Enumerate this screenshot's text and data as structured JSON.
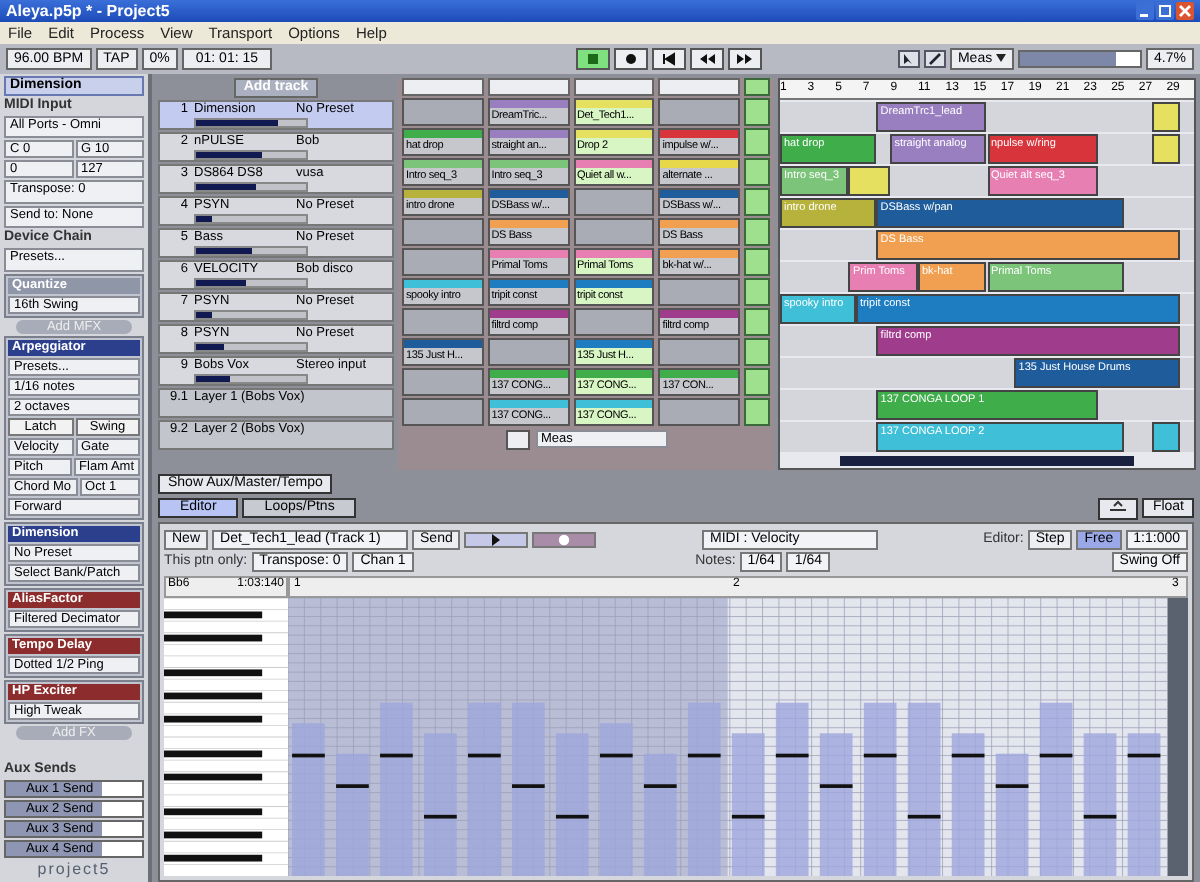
{
  "window": {
    "title": "Aleya.p5p * - Project5"
  },
  "menu": [
    "File",
    "Edit",
    "Process",
    "View",
    "Transport",
    "Options",
    "Help"
  ],
  "toolbar": {
    "tempo": "96.00 BPM",
    "tap": "TAP",
    "swing": "0%",
    "position": "01: 01: 15",
    "snap": "Meas",
    "zoom": "4.7%",
    "zoom_slider": {
      "level": 0.8
    },
    "transport": [
      {
        "kind": "play",
        "selected": true
      },
      {
        "kind": "record",
        "selected": false
      },
      {
        "kind": "start",
        "selected": false
      },
      {
        "kind": "rewind",
        "selected": false
      },
      {
        "kind": "forward",
        "selected": false
      }
    ]
  },
  "instrument_panel": {
    "title": "Dimension",
    "midi_input": "MIDI Input",
    "port": "All Ports - Omni",
    "low_note": "C 0",
    "high_note": "G 10",
    "low_velocity": "0",
    "high_velocity": "127",
    "transpose": "Transpose: 0",
    "send_to": "Send to: None"
  },
  "device_chain": {
    "title": "Device Chain",
    "presets": "Presets...",
    "quantize": {
      "title": "Quantize",
      "value": "16th Swing"
    },
    "add_mfx": "Add MFX",
    "arpeggiator": {
      "title": "Arpeggiator",
      "presets": "Presets...",
      "rate": "1/16 notes",
      "octaves": "2 octaves",
      "buttons": [
        "Latch",
        "Swing"
      ],
      "params": [
        "Velocity",
        "Gate",
        "Pitch",
        "Flam Amt"
      ],
      "chord": "Chord Mo",
      "octave": "Oct 1",
      "direction": "Forward"
    },
    "effects": [
      {
        "kind": "synth",
        "title": "Dimension",
        "values": [
          "No Preset",
          "Select Bank/Patch"
        ]
      },
      {
        "kind": "fx",
        "title": "AliasFactor",
        "values": [
          "Filtered Decimator"
        ]
      },
      {
        "kind": "fx",
        "title": "Tempo Delay",
        "values": [
          "Dotted 1/2 Ping"
        ]
      },
      {
        "kind": "fx",
        "title": "HP Exciter",
        "values": [
          "High Tweak"
        ]
      }
    ],
    "add_fx": "Add FX"
  },
  "aux_sends": {
    "title": "Aux Sends",
    "sends": [
      {
        "label": "Aux 1 Send",
        "level": 0.7
      },
      {
        "label": "Aux 2 Send",
        "level": 0.7
      },
      {
        "label": "Aux 3 Send",
        "level": 0.7
      },
      {
        "label": "Aux 4 Send",
        "level": 0.7
      }
    ]
  },
  "logo": "project5",
  "add_track": "Add track",
  "tracks": [
    {
      "kind": "track",
      "number": "1",
      "name": "Dimension",
      "preset": "No Preset",
      "selected": true,
      "level": 0.75
    },
    {
      "kind": "track",
      "number": "2",
      "name": "nPULSE",
      "preset": "Bob",
      "selected": false,
      "level": 0.6
    },
    {
      "kind": "track",
      "number": "3",
      "name": "DS864 DS8",
      "preset": "vusa",
      "selected": false,
      "level": 0.55
    },
    {
      "kind": "track",
      "number": "4",
      "name": "PSYN",
      "preset": "No Preset",
      "selected": false,
      "level": 0.15
    },
    {
      "kind": "track",
      "number": "5",
      "name": "Bass",
      "preset": "No Preset",
      "selected": false,
      "level": 0.5
    },
    {
      "kind": "track",
      "number": "6",
      "name": "VELOCITY",
      "preset": "Bob disco",
      "selected": false,
      "level": 0.45
    },
    {
      "kind": "track",
      "number": "7",
      "name": "PSYN",
      "preset": "No Preset",
      "selected": false,
      "level": 0.15
    },
    {
      "kind": "track",
      "number": "8",
      "name": "PSYN",
      "preset": "No Preset",
      "selected": false,
      "level": 0.25
    },
    {
      "kind": "track",
      "number": "9",
      "name": "Bobs Vox",
      "preset": "Stereo input",
      "selected": false,
      "level": 0.3
    },
    {
      "kind": "layer",
      "number": "9.1",
      "name": "Layer 1 (Bobs Vox)",
      "selected": false
    },
    {
      "kind": "layer",
      "number": "9.2",
      "name": "Layer 2 (Bobs Vox)",
      "selected": false
    }
  ],
  "clip_grid": {
    "snap": "Meas",
    "rows": [
      [
        {
          "kind": "empty"
        },
        {
          "kind": "clip",
          "name": "DreamTric...",
          "color": "#9a7fc0",
          "playing": false
        },
        {
          "kind": "clip",
          "name": "Det_Tech1...",
          "color": "#e6e060",
          "playing": true
        },
        {
          "kind": "empty"
        }
      ],
      [
        {
          "kind": "clip",
          "name": "hat drop",
          "color": "#3fae4a",
          "playing": false
        },
        {
          "kind": "clip",
          "name": "straight an...",
          "color": "#9a7fc0",
          "playing": false
        },
        {
          "kind": "clip",
          "name": "Drop 2",
          "color": "#e6e060",
          "playing": true
        },
        {
          "kind": "clip",
          "name": "impulse w/...",
          "color": "#d8343c",
          "playing": false
        }
      ],
      [
        {
          "kind": "clip",
          "name": "Intro seq_3",
          "color": "#7cc47a",
          "playing": false
        },
        {
          "kind": "clip",
          "name": "Intro seq_3",
          "color": "#7cc47a",
          "playing": false
        },
        {
          "kind": "clip",
          "name": "Quiet all w...",
          "color": "#e77fb2",
          "playing": true
        },
        {
          "kind": "clip",
          "name": "alternate ...",
          "color": "#e6d84a",
          "playing": false
        }
      ],
      [
        {
          "kind": "clip",
          "name": "intro drone",
          "color": "#b6b23c",
          "playing": false
        },
        {
          "kind": "clip",
          "name": "DSBass w/...",
          "color": "#1e5c9c",
          "playing": false
        },
        {
          "kind": "empty"
        },
        {
          "kind": "clip",
          "name": "DSBass w/...",
          "color": "#1e5c9c",
          "playing": false
        }
      ],
      [
        {
          "kind": "empty"
        },
        {
          "kind": "clip",
          "name": "DS Bass",
          "color": "#f0a050",
          "playing": false
        },
        {
          "kind": "empty"
        },
        {
          "kind": "clip",
          "name": "DS Bass",
          "color": "#f0a050",
          "playing": false
        }
      ],
      [
        {
          "kind": "empty"
        },
        {
          "kind": "clip",
          "name": "Primal Toms",
          "color": "#e77fb2",
          "playing": false
        },
        {
          "kind": "clip",
          "name": "Primal Toms",
          "color": "#e77fb2",
          "playing": true
        },
        {
          "kind": "clip",
          "name": "bk-hat w/...",
          "color": "#f0a050",
          "playing": false
        }
      ],
      [
        {
          "kind": "clip",
          "name": "spooky intro",
          "color": "#3fc0d8",
          "playing": false
        },
        {
          "kind": "clip",
          "name": "tripit const",
          "color": "#1e7cc0",
          "playing": false
        },
        {
          "kind": "clip",
          "name": "tripit const",
          "color": "#1e7cc0",
          "playing": true
        },
        {
          "kind": "empty"
        }
      ],
      [
        {
          "kind": "empty"
        },
        {
          "kind": "clip",
          "name": "filtrd comp",
          "color": "#a03c8c",
          "playing": false
        },
        {
          "kind": "empty"
        },
        {
          "kind": "clip",
          "name": "filtrd comp",
          "color": "#a03c8c",
          "playing": false
        }
      ],
      [
        {
          "kind": "clip",
          "name": "135 Just H...",
          "color": "#1e5c9c",
          "playing": false
        },
        {
          "kind": "empty"
        },
        {
          "kind": "clip",
          "name": "135 Just H...",
          "color": "#1e7cc0",
          "playing": true
        },
        {
          "kind": "empty"
        }
      ],
      [
        {
          "kind": "empty"
        },
        {
          "kind": "clip",
          "name": "137 CONG...",
          "color": "#3fae4a",
          "playing": false
        },
        {
          "kind": "clip",
          "name": "137 CONG...",
          "color": "#3fae4a",
          "playing": true
        },
        {
          "kind": "clip",
          "name": "137 CON...",
          "color": "#3fae4a",
          "playing": false
        }
      ],
      [
        {
          "kind": "empty"
        },
        {
          "kind": "clip",
          "name": "137 CONG...",
          "color": "#3fc0d8",
          "playing": false
        },
        {
          "kind": "clip",
          "name": "137 CONG...",
          "color": "#3fc0d8",
          "playing": true
        },
        {
          "kind": "empty"
        }
      ]
    ]
  },
  "arrangement": {
    "ruler": [
      "1",
      "3",
      "5",
      "7",
      "9",
      "11",
      "13",
      "15",
      "17",
      "19",
      "21",
      "23",
      "25",
      "27",
      "29"
    ],
    "rows": [
      [
        {
          "name": "DreamTrc1_lead",
          "color": "#9a7fc0"
        },
        {
          "color": "#e6e060"
        }
      ],
      [
        {
          "name": "hat drop",
          "color": "#3fae4a"
        },
        {
          "name": "straight analog",
          "color": "#9a7fc0"
        },
        {
          "name": "npulse w/ring",
          "color": "#d8343c"
        },
        {
          "color": "#e6e060"
        }
      ],
      [
        {
          "name": "Intro seq_3",
          "color": "#7cc47a"
        },
        {
          "color": "#e6e060"
        },
        {
          "name": "Quiet alt seq_3",
          "color": "#e77fb2"
        }
      ],
      [
        {
          "name": "intro drone",
          "color": "#b6b23c"
        },
        {
          "name": "DSBass w/pan",
          "color": "#1e5c9c"
        }
      ],
      [
        {
          "name": "DS Bass",
          "color": "#f0a050"
        }
      ],
      [
        {
          "name": "Prim Toms",
          "color": "#e77fb2"
        },
        {
          "name": "bk-hat",
          "color": "#f0a050"
        },
        {
          "name": "Primal Toms",
          "color": "#7cc47a"
        }
      ],
      [
        {
          "name": "spooky intro",
          "color": "#3fc0d8"
        },
        {
          "name": "tripit const",
          "color": "#1e7cc0"
        }
      ],
      [
        {
          "name": "filtrd comp",
          "color": "#a03c8c"
        }
      ],
      [
        {
          "name": "135 Just House Drums",
          "color": "#1e5c9c"
        }
      ],
      [
        {
          "name": "137 CONGA LOOP 1",
          "color": "#3fae4a"
        }
      ],
      [
        {
          "name": "137 CONGA LOOP 2",
          "color": "#3fc0d8"
        },
        {
          "color": "#3fc0d8"
        }
      ]
    ]
  },
  "editor": {
    "show_aux": "Show Aux/Master/Tempo",
    "tabs": [
      {
        "label": "Editor",
        "selected": true
      },
      {
        "label": "Loops/Ptns",
        "selected": false
      }
    ],
    "float": "Float",
    "new": "New",
    "pattern": "Det_Tech1_lead (Track 1)",
    "send": "Send",
    "controller": "MIDI : Velocity",
    "editor_label": "Editor:",
    "modes": [
      {
        "label": "Step",
        "selected": false
      },
      {
        "label": "Free",
        "selected": true
      }
    ],
    "step_value": "1:1:000",
    "ptn_only": "This ptn only:",
    "transpose": "Transpose: 0",
    "channel": "Chan 1",
    "notes_label": "Notes:",
    "note_length": "1/64",
    "note_length_2": "1/64",
    "swing": "Swing Off",
    "pitch": "Bb6",
    "time": "1:03:140",
    "ruler": [
      "1",
      "2",
      "3"
    ]
  }
}
